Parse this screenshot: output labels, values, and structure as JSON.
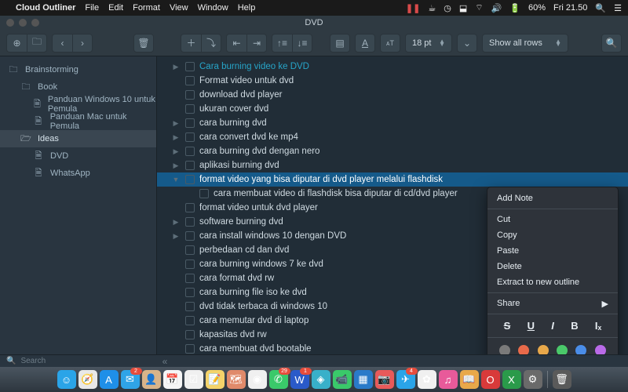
{
  "menubar": {
    "app": "Cloud Outliner",
    "items": [
      "File",
      "Edit",
      "Format",
      "View",
      "Window",
      "Help"
    ],
    "battery": "60%",
    "clock": "Fri 21.50"
  },
  "titlebar": {
    "title": "DVD"
  },
  "toolbar": {
    "fontsize": "18 pt",
    "show": "Show all rows"
  },
  "sidebar": {
    "items": [
      {
        "label": "Brainstorming",
        "depth": 0,
        "icon": "folder",
        "sel": false
      },
      {
        "label": "Book",
        "depth": 1,
        "icon": "folder",
        "sel": false
      },
      {
        "label": "Panduan Windows 10 untuk Pemula",
        "depth": 2,
        "icon": "doc",
        "sel": false
      },
      {
        "label": "Panduan Mac untuk Pemula",
        "depth": 2,
        "icon": "doc",
        "sel": false
      },
      {
        "label": "Ideas",
        "depth": 1,
        "icon": "folder-open",
        "sel": true
      },
      {
        "label": "DVD",
        "depth": 2,
        "icon": "doc",
        "sel": false
      },
      {
        "label": "WhatsApp",
        "depth": 2,
        "icon": "doc",
        "sel": false
      }
    ]
  },
  "rows": [
    {
      "txt": "Cara burning video ke DVD",
      "d": 1,
      "arr": "▶",
      "hl": true
    },
    {
      "txt": "Format video untuk dvd",
      "d": 1,
      "arr": ""
    },
    {
      "txt": "download dvd player",
      "d": 1,
      "arr": ""
    },
    {
      "txt": "ukuran cover dvd",
      "d": 1,
      "arr": ""
    },
    {
      "txt": "cara burning dvd",
      "d": 1,
      "arr": "▶"
    },
    {
      "txt": "cara convert dvd ke mp4",
      "d": 1,
      "arr": "▶"
    },
    {
      "txt": "cara burning dvd dengan nero",
      "d": 1,
      "arr": "▶"
    },
    {
      "txt": "aplikasi burning dvd",
      "d": 1,
      "arr": "▶"
    },
    {
      "txt": "format video yang bisa diputar di dvd player melalui flashdisk",
      "d": 1,
      "arr": "▼",
      "sel": true
    },
    {
      "txt": "cara membuat video di flashdisk bisa diputar di cd/dvd player",
      "d": 2,
      "arr": ""
    },
    {
      "txt": "format video untuk dvd player",
      "d": 1,
      "arr": ""
    },
    {
      "txt": "software burning dvd",
      "d": 1,
      "arr": "▶"
    },
    {
      "txt": "cara install windows 10 dengan DVD",
      "d": 1,
      "arr": "▶"
    },
    {
      "txt": "perbedaan cd dan dvd",
      "d": 1,
      "arr": ""
    },
    {
      "txt": "cara burning windows 7 ke dvd",
      "d": 1,
      "arr": ""
    },
    {
      "txt": "cara format dvd rw",
      "d": 1,
      "arr": ""
    },
    {
      "txt": "cara burning file iso ke dvd",
      "d": 1,
      "arr": ""
    },
    {
      "txt": "dvd tidak terbaca di windows 10",
      "d": 1,
      "arr": ""
    },
    {
      "txt": "cara memutar dvd di laptop",
      "d": 1,
      "arr": ""
    },
    {
      "txt": "kapasitas dvd rw",
      "d": 1,
      "arr": ""
    },
    {
      "txt": "cara membuat dvd bootable",
      "d": 1,
      "arr": ""
    }
  ],
  "ctx": {
    "items": [
      "Add Note",
      "Cut",
      "Copy",
      "Paste",
      "Delete",
      "Extract to new outline"
    ],
    "share": "Share",
    "fmt": [
      "S",
      "U",
      "I",
      "B",
      "Iₓ"
    ],
    "colors": [
      "#7a7a7a",
      "#e86a4a",
      "#e8a84a",
      "#4ac96a",
      "#4a8de8",
      "#b96ae8"
    ]
  },
  "search": {
    "placeholder": "Search"
  },
  "dock": {
    "items": [
      {
        "name": "finder",
        "bg": "#2aa4e8",
        "glyph": "☺"
      },
      {
        "name": "safari",
        "bg": "#e8e8e8",
        "glyph": "🧭"
      },
      {
        "name": "appstore",
        "bg": "#1f8fe8",
        "glyph": "A"
      },
      {
        "name": "mail",
        "bg": "#2fa4e8",
        "glyph": "✉",
        "badge": "2"
      },
      {
        "name": "contacts",
        "bg": "#d8b48a",
        "glyph": "👤"
      },
      {
        "name": "calendar",
        "bg": "#f5f5f5",
        "glyph": "📅"
      },
      {
        "name": "reminders",
        "bg": "#f0f0f0",
        "glyph": "☑"
      },
      {
        "name": "notes",
        "bg": "#f4d36a",
        "glyph": "📝"
      },
      {
        "name": "maps",
        "bg": "#e08a6a",
        "glyph": "🗺"
      },
      {
        "name": "chrome",
        "bg": "#f0f0f0",
        "glyph": "◉"
      },
      {
        "name": "whatsapp",
        "bg": "#3ac96a",
        "glyph": "✆",
        "badge": "29"
      },
      {
        "name": "word",
        "bg": "#2a5ac9",
        "glyph": "W",
        "badge": "1"
      },
      {
        "name": "outliner",
        "bg": "#38b0c9",
        "glyph": "◈"
      },
      {
        "name": "facetime",
        "bg": "#3ac96a",
        "glyph": "📹"
      },
      {
        "name": "trello",
        "bg": "#2a7ac9",
        "glyph": "▦"
      },
      {
        "name": "photobooth",
        "bg": "#e85a5a",
        "glyph": "📷"
      },
      {
        "name": "telegram",
        "bg": "#2aa4e8",
        "glyph": "✈",
        "badge": "4"
      },
      {
        "name": "photos",
        "bg": "#f0f0f0",
        "glyph": "✿"
      },
      {
        "name": "itunes",
        "bg": "#e85a9a",
        "glyph": "♫"
      },
      {
        "name": "ibooks",
        "bg": "#e8a84a",
        "glyph": "📖"
      },
      {
        "name": "opera",
        "bg": "#d83a3a",
        "glyph": "O"
      },
      {
        "name": "excel",
        "bg": "#2a9a4a",
        "glyph": "X"
      },
      {
        "name": "sysprefs",
        "bg": "#6a6a6a",
        "glyph": "⚙"
      }
    ],
    "right": [
      {
        "name": "bin",
        "bg": "#5a5a5a",
        "glyph": "🗑"
      }
    ]
  }
}
